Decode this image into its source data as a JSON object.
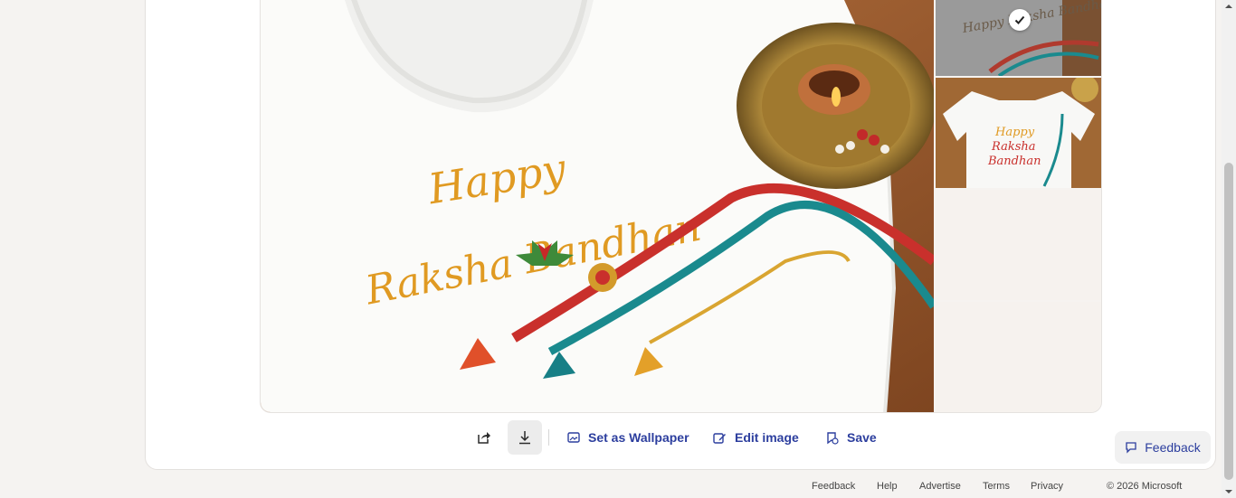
{
  "toolbar": {
    "share_icon": "share-icon",
    "download_icon": "download-icon",
    "wallpaper_label": "Set as Wallpaper",
    "wallpaper_icon": "wallpaper-icon",
    "edit_label": "Edit image",
    "edit_icon": "edit-icon",
    "save_label": "Save",
    "save_icon": "save-icon"
  },
  "image": {
    "embroidered_line1": "Happy",
    "embroidered_line2": "Raksha Bandhan"
  },
  "thumbnails": [
    {
      "selected": true,
      "text": "Happy Raksha Bandhan"
    },
    {
      "selected": false,
      "line1": "Happy",
      "line2": "Raksha",
      "line3": "Bandhan"
    },
    {
      "selected": false
    },
    {
      "selected": false
    }
  ],
  "feedback_button": {
    "label": "Feedback",
    "icon": "chat-icon"
  },
  "footer": {
    "links": [
      "Feedback",
      "Help",
      "Advertise",
      "Terms",
      "Privacy"
    ],
    "copyright": "© 2026 Microsoft"
  },
  "colors": {
    "accent": "#2c3e9e",
    "wood": "#9a5a2c",
    "embroidery": "#e09a22"
  }
}
